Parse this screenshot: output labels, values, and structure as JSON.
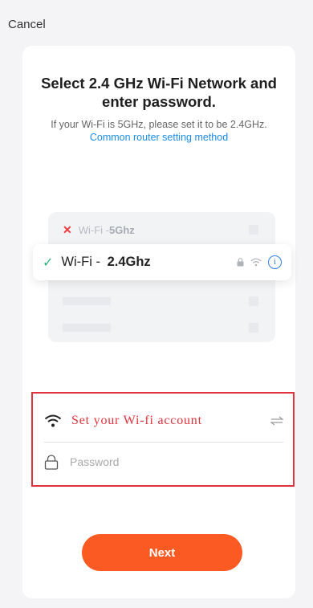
{
  "header": {
    "cancel_label": "Cancel"
  },
  "title": "Select 2.4 GHz Wi-Fi Network and enter password.",
  "subtitle": {
    "text": "If your Wi-Fi is 5GHz, please set it to be 2.4GHz.",
    "link": "Common router setting method"
  },
  "illustration": {
    "networks": [
      {
        "status": "invalid",
        "prefix": "Wi-Fi - ",
        "band": "5Ghz"
      },
      {
        "status": "valid",
        "prefix": "Wi-Fi - ",
        "band": "2.4Ghz"
      }
    ],
    "icons": [
      "lock-icon",
      "wifi-icon",
      "info-icon"
    ],
    "info_glyph": "i"
  },
  "form": {
    "ssid_value": "Set your Wi-fi account",
    "password_placeholder": "Password"
  },
  "next_label": "Next",
  "colors": {
    "accent": "#fb5a23",
    "link": "#1a8cf0",
    "highlight_border": "#e0333d",
    "check": "#2ab27b",
    "error_x": "#ef3b3b"
  }
}
